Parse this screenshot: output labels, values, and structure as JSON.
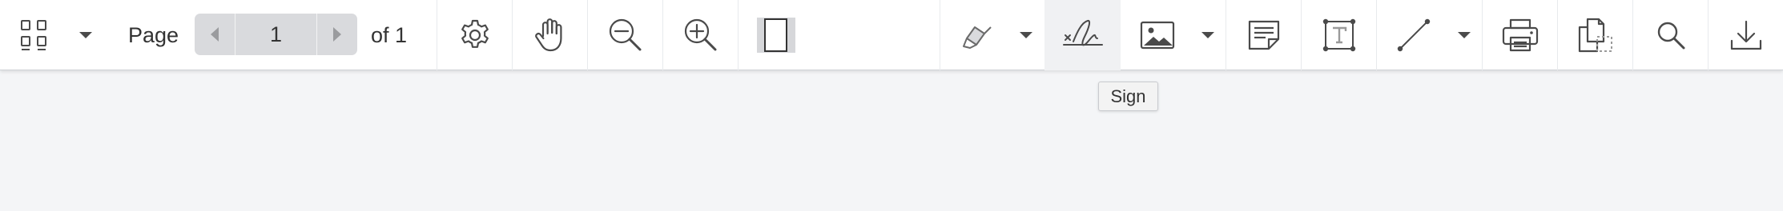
{
  "toolbar": {
    "page_label": "Page",
    "page_value": "1",
    "of_label": "of 1"
  },
  "icons": {
    "thumbnails": "thumbnails-icon",
    "thumbnails_dropdown": "chevron-down-icon",
    "prev_page": "triangle-left-icon",
    "next_page": "triangle-right-icon",
    "settings": "gear-icon",
    "pan": "hand-icon",
    "zoom_out": "zoom-out-icon",
    "zoom_in": "zoom-in-icon",
    "fit_page": "fit-page-icon",
    "highlight": "highlighter-icon",
    "sign": "signature-icon",
    "image": "image-icon",
    "note": "sticky-note-icon",
    "free_text": "text-box-icon",
    "line": "line-icon",
    "print": "printer-icon",
    "copy": "copy-icon",
    "search": "search-icon",
    "download": "download-icon"
  },
  "tooltip": {
    "text": "Sign"
  },
  "colors": {
    "toolbar_bg": "#ffffff",
    "page_bg": "#f4f5f7",
    "icon": "#4a4a4a",
    "pager_bg": "#d9dadd",
    "active_bg": "#f0f1f3"
  }
}
